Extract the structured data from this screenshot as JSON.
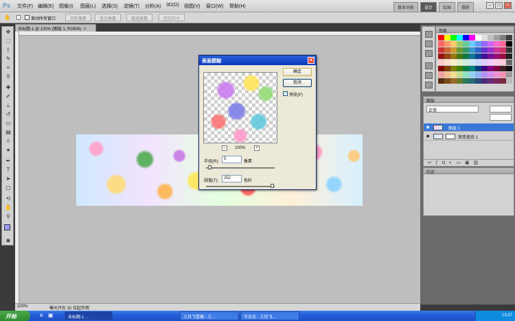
{
  "app": {
    "logo": "Ps"
  },
  "menu": [
    "文件(F)",
    "编辑(E)",
    "图像(I)",
    "图层(L)",
    "选择(S)",
    "滤镜(T)",
    "分析(A)",
    "3D(D)",
    "视图(V)",
    "窗口(W)",
    "帮助(H)"
  ],
  "workspace": {
    "items": [
      "基本功能",
      "设计",
      "绘画",
      "摄影"
    ],
    "active_index": 1
  },
  "options": {
    "scroll_all_label": "滚动所有窗口",
    "actual_pixels": "实际像素",
    "fit_screen": "适合屏幕",
    "fill_screen": "填充屏幕",
    "print_size": "打印尺寸"
  },
  "document": {
    "tab_title": "未标题-1 @ 100% (图层 1, RGB/8)",
    "zoom": "100%",
    "status": "曝光只在 32 位起作用"
  },
  "panels": {
    "color_tab": "色板",
    "layers_tab": "图层",
    "blend_mode": "正常",
    "layers": [
      {
        "name": "图层 1",
        "selected": true
      },
      {
        "name": "渐变填充 1",
        "selected": false
      }
    ],
    "history_tab": "历史"
  },
  "dialog": {
    "title": "表面模糊",
    "ok": "确定",
    "cancel": "取消",
    "preview_label": "预览(P)",
    "preview_checked": true,
    "preview_zoom": "100%",
    "radius_label": "半径(R):",
    "radius_value": "5",
    "radius_unit": "像素",
    "radius_level": 0.03,
    "threshold_label": "阈值(T):",
    "threshold_value": "252",
    "threshold_unit": "色阶",
    "threshold_level": 0.99
  },
  "taskbar": {
    "start": "开始",
    "items": [
      "未标题-1 ...",
      "三月飞雪薇 - 三...",
      "写日志 - 三月飞..."
    ],
    "time": "13:37"
  },
  "swatch_colors": [
    "#ff0000",
    "#ffff00",
    "#00ff00",
    "#00ffff",
    "#0000ff",
    "#ff00ff",
    "#ffffff",
    "#e0e0e0",
    "#c0c0c0",
    "#a0a0a0",
    "#808080",
    "#404040",
    "#ff6666",
    "#ff9966",
    "#ffcc66",
    "#99cc66",
    "#66cc99",
    "#66ccff",
    "#6699ff",
    "#9966ff",
    "#cc66ff",
    "#ff66cc",
    "#ff6699",
    "#000000",
    "#cc3333",
    "#cc6633",
    "#cc9933",
    "#669933",
    "#339966",
    "#3399cc",
    "#3366cc",
    "#6633cc",
    "#9933cc",
    "#cc3399",
    "#cc3366",
    "#333333",
    "#991111",
    "#994411",
    "#997711",
    "#447711",
    "#117744",
    "#117799",
    "#114499",
    "#441199",
    "#771199",
    "#991177",
    "#991144",
    "#222222",
    "#ffcccc",
    "#ffe0cc",
    "#fff0cc",
    "#e0f0cc",
    "#ccf0e0",
    "#cce8ff",
    "#ccd8ff",
    "#e0ccff",
    "#f0ccff",
    "#ffcce8",
    "#ffccd8",
    "#666666",
    "#800000",
    "#804000",
    "#808000",
    "#408000",
    "#008040",
    "#008080",
    "#004080",
    "#400080",
    "#800080",
    "#800040",
    "#402020",
    "#111111",
    "#f0a0a0",
    "#f0c090",
    "#f0e090",
    "#c0e090",
    "#90e0c0",
    "#90d0f0",
    "#90b0f0",
    "#b090f0",
    "#d090f0",
    "#f090d0",
    "#f090b0",
    "#999999",
    "#5a2d0c",
    "#7a4a1a",
    "#9a6a2a",
    "#6a7a2a",
    "#2a7a5a",
    "#2a6a7a",
    "#2a4a7a",
    "#4a2a7a",
    "#6a2a7a",
    "#7a2a5a",
    "#7a2a3a",
    "#bbbbbb"
  ]
}
